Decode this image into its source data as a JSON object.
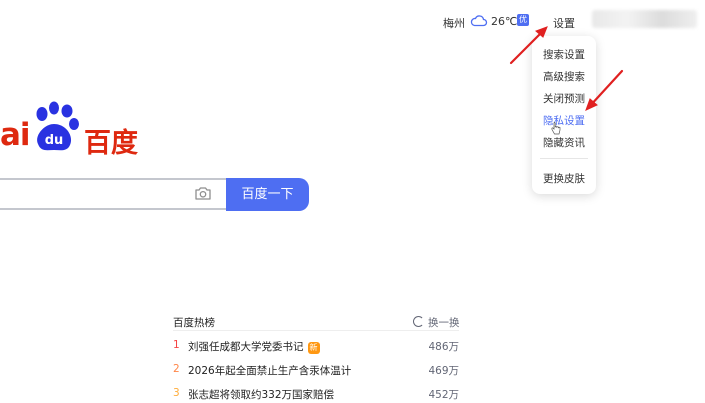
{
  "header": {
    "city": "梅州",
    "temperature": "26℃",
    "air_quality_badge": "优",
    "settings_label": "设置"
  },
  "settings_menu": {
    "items": [
      {
        "label": "搜索设置",
        "active": false
      },
      {
        "label": "高级搜索",
        "active": false
      },
      {
        "label": "关闭预测",
        "active": false
      },
      {
        "label": "隐私设置",
        "active": true
      },
      {
        "label": "隐藏资讯",
        "active": false
      },
      {
        "label": "更换皮肤",
        "active": false
      }
    ]
  },
  "logo": {
    "latin": "ai",
    "paw": "du",
    "chinese": "百度"
  },
  "search": {
    "button_label": "百度一下",
    "camera_icon": "camera-icon"
  },
  "hot_list": {
    "title": "百度热榜",
    "refresh_label": "换一换",
    "items": [
      {
        "rank": "1",
        "text": "刘强任成都大学党委书记",
        "badge": "新",
        "heat": "486万",
        "rank_color": "#f54545"
      },
      {
        "rank": "2",
        "text": "2026年起全面禁止生产含汞体温计",
        "heat": "469万",
        "rank_color": "#ff8547"
      },
      {
        "rank": "3",
        "text": "张志超将领取约332万国家赔偿",
        "heat": "452万",
        "rank_color": "#ffac38"
      }
    ]
  },
  "colors": {
    "brand_red": "#de2910",
    "brand_blue": "#4e6ef2",
    "annotation_arrow": "#e02020"
  }
}
